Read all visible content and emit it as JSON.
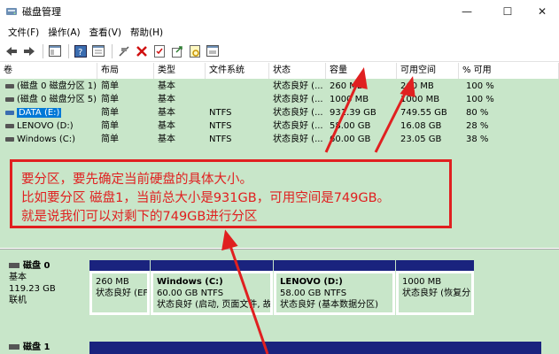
{
  "window": {
    "title": "磁盘管理",
    "minimize": "—",
    "maximize": "☐",
    "close": "✕"
  },
  "menu": [
    "文件(F)",
    "操作(A)",
    "查看(V)",
    "帮助(H)"
  ],
  "toolbar_icons": [
    "back-arrow-icon",
    "forward-arrow-icon",
    "console-tree-icon",
    "help-icon",
    "properties-icon",
    "connect-icon",
    "delete-icon",
    "check-icon",
    "export-icon",
    "rescan-icon",
    "format-icon"
  ],
  "columns": [
    "卷",
    "布局",
    "类型",
    "文件系统",
    "状态",
    "容量",
    "可用空间",
    "% 可用"
  ],
  "rows": [
    {
      "vol": "(磁盘 0 磁盘分区 1)",
      "layout": "简单",
      "type": "基本",
      "fs": "",
      "status": "状态良好 (...",
      "cap": "260 MB",
      "free": "260 MB",
      "pct": "100 %"
    },
    {
      "vol": "(磁盘 0 磁盘分区 5)",
      "layout": "简单",
      "type": "基本",
      "fs": "",
      "status": "状态良好 (...",
      "cap": "1000 MB",
      "free": "1000 MB",
      "pct": "100 %"
    },
    {
      "vol": "DATA (E:)",
      "layout": "简单",
      "type": "基本",
      "fs": "NTFS",
      "status": "状态良好 (...",
      "cap": "931.39 GB",
      "free": "749.55 GB",
      "pct": "80 %"
    },
    {
      "vol": "LENOVO (D:)",
      "layout": "简单",
      "type": "基本",
      "fs": "NTFS",
      "status": "状态良好 (...",
      "cap": "58.00 GB",
      "free": "16.08 GB",
      "pct": "28 %"
    },
    {
      "vol": "Windows (C:)",
      "layout": "简单",
      "type": "基本",
      "fs": "NTFS",
      "status": "状态良好 (...",
      "cap": "60.00 GB",
      "free": "23.05 GB",
      "pct": "38 %"
    }
  ],
  "annotation": {
    "line1": "要分区，要先确定当前硬盘的具体大小。",
    "line2": "比如要分区 磁盘1，当前总大小是931GB，可用空间是749GB。",
    "line3": "就是说我们可以对剩下的749GB进行分区"
  },
  "disk0": {
    "name": "磁盘 0",
    "type": "基本",
    "size": "119.23 GB",
    "state": "联机",
    "partitions": [
      {
        "name": "",
        "size": "260 MB",
        "status": "状态良好 (EF"
      },
      {
        "name": "Windows  (C:)",
        "size": "60.00 GB NTFS",
        "status": "状态良好 (启动, 页面文件, 故"
      },
      {
        "name": "LENOVO  (D:)",
        "size": "58.00 GB NTFS",
        "status": "状态良好 (基本数据分区)"
      },
      {
        "name": "",
        "size": "1000 MB",
        "status": "状态良好 (恢复分"
      }
    ]
  },
  "disk1": {
    "name": "磁盘 1"
  }
}
